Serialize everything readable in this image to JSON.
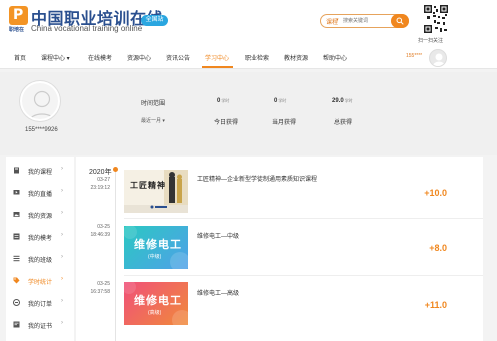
{
  "header": {
    "logo_text_cn": "中国职业培训在线",
    "logo_text_en": "China vocational training online",
    "logo_sub": "职培在",
    "site_badge": "全国站",
    "search_type": "课程",
    "search_placeholder": "搜索关键词",
    "qr_label": "扫一扫关注"
  },
  "nav": {
    "items": [
      {
        "label": "首页"
      },
      {
        "label": "课程中心 ▾"
      },
      {
        "label": "在线模考"
      },
      {
        "label": "资源中心"
      },
      {
        "label": "资讯公告"
      },
      {
        "label": "学习中心"
      },
      {
        "label": "职业检索"
      },
      {
        "label": "教材资源"
      },
      {
        "label": "帮助中心"
      }
    ],
    "active_index": 5,
    "user": "155****"
  },
  "profile": {
    "name": "155****9926",
    "range_label": "时间范围",
    "range_select": "最近一月 ▾",
    "stats": [
      {
        "value": "0",
        "unit": "学时",
        "label": "今日获得"
      },
      {
        "value": "0",
        "unit": "学时",
        "label": "当月获得"
      },
      {
        "value": "29.0",
        "unit": "学时",
        "label": "总获得"
      }
    ]
  },
  "sidebar": {
    "items": [
      {
        "label": "我的课程",
        "icon": "book-icon"
      },
      {
        "label": "我的直播",
        "icon": "live-icon"
      },
      {
        "label": "我的资源",
        "icon": "image-icon"
      },
      {
        "label": "我的模考",
        "icon": "exam-icon"
      },
      {
        "label": "我的班级",
        "icon": "class-icon"
      },
      {
        "label": "学时统计",
        "icon": "tag-icon"
      },
      {
        "label": "我的订单",
        "icon": "order-icon"
      },
      {
        "label": "我的证书",
        "icon": "certificate-icon"
      }
    ],
    "active_index": 5,
    "arrow": "›"
  },
  "timeline": {
    "year": "2020年",
    "records": [
      {
        "date": "03-27",
        "time": "23:19:12",
        "thumb_text": "工匠精神",
        "title": "工匠精神—企业新型学徒制通用素质知识课程",
        "score": "+10.0"
      },
      {
        "date": "03-25",
        "time": "18:46:39",
        "thumb_text": "维修电工",
        "thumb_sub": "(中级)",
        "title": "维修电工—中级",
        "score": "+8.0"
      },
      {
        "date": "03-25",
        "time": "16:37:58",
        "thumb_text": "维修电工",
        "thumb_sub": "(高级)",
        "title": "维修电工—高级",
        "score": "+11.0"
      }
    ]
  },
  "colors": {
    "accent": "#f0871f",
    "brand_blue": "#2a4f8f",
    "badge_blue": "#2aa6e0"
  }
}
